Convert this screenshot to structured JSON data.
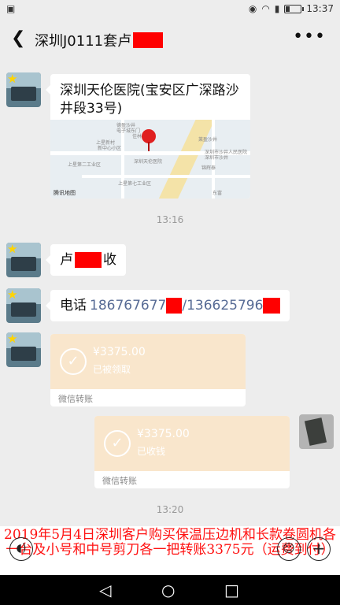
{
  "status_bar": {
    "left_icon": "app-notification-icon",
    "time": "13:37",
    "icons": [
      "eye-icon",
      "wifi-icon",
      "sim-icon",
      "battery-icon"
    ],
    "battery_level": 0.3
  },
  "header": {
    "back_glyph": "❮",
    "title": "深圳J0111套卢",
    "more_glyph": "•••"
  },
  "messages": {
    "location": {
      "title": "深圳天伦医院(宝安区广深路沙井段33号)",
      "map_provider": "腾讯地图",
      "map_labels": [
        "德盈沙井",
        "电子城东门",
        "佳林",
        "上星新村",
        "新中心小区",
        "深圳天伦医院",
        "上星第二工业区",
        "上星第七工业区",
        "莱盈沙井",
        "深圳市沙井人民医院",
        "深圳市沙井",
        "锦辉泰",
        "东富"
      ]
    },
    "time1": "13:16",
    "msg_name": {
      "prefix": "卢",
      "suffix": "收"
    },
    "msg_phone": {
      "label": "电话",
      "phone1": "186767677",
      "sep": "/",
      "phone2": "136625796"
    },
    "transfer_received": {
      "amount": "¥3375.00",
      "status": "已被领取",
      "footer": "微信转账"
    },
    "transfer_collected": {
      "amount": "¥3375.00",
      "status": "已收钱",
      "footer": "微信转账"
    },
    "time2": "13:20"
  },
  "caption": {
    "text": "2019年5月4日深圳客户购买保温压边机和长款卷圆机各一台及小号和中号剪刀各一把转账3375元（运费到付）"
  },
  "input_bar": {
    "voice_glyph": "◖)",
    "emoji_glyph": "☺",
    "plus_glyph": "+"
  },
  "system_nav": {
    "back_glyph": "◁",
    "home_glyph": "○",
    "recent_glyph": "□"
  },
  "colors": {
    "background": "#ededed",
    "transfer_orange": "#f9e6cc",
    "redaction": "#ff0000",
    "link_blue": "#576b95",
    "caption_red": "#ff1010"
  }
}
